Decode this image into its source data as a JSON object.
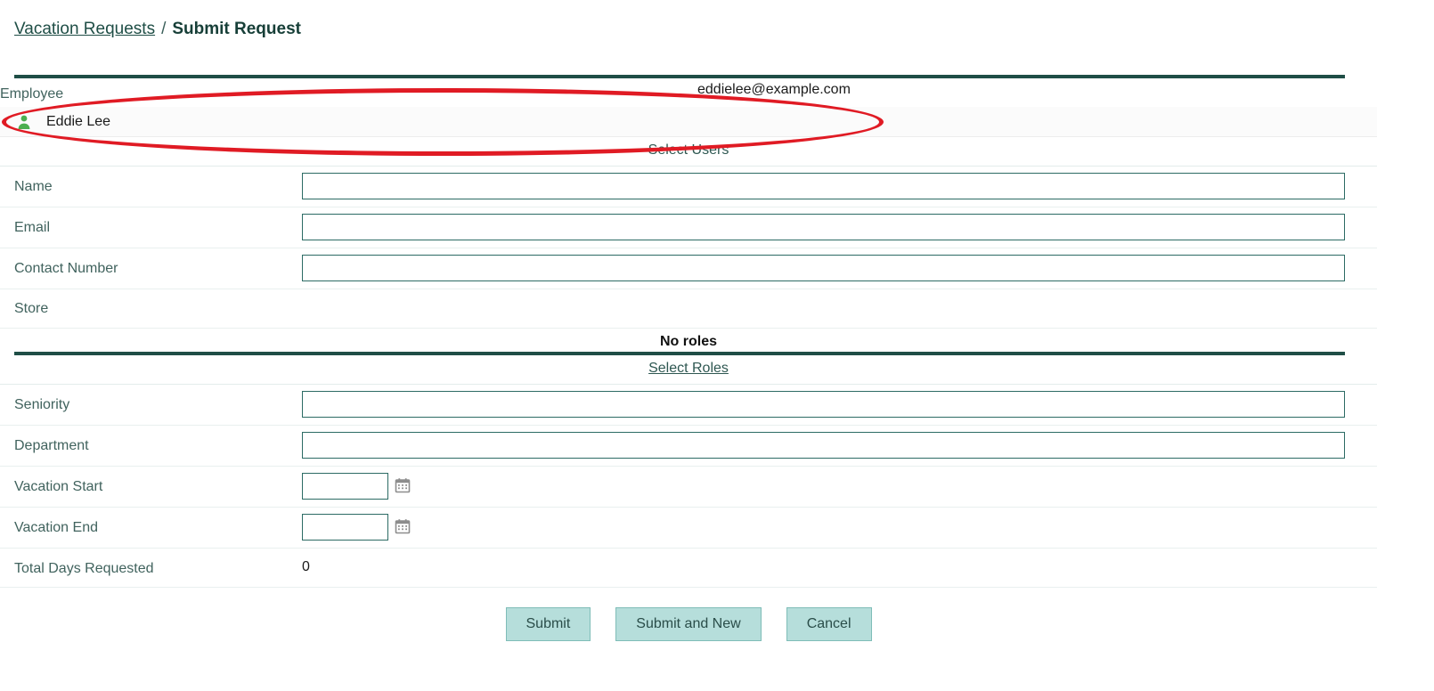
{
  "breadcrumb": {
    "parent": "Vacation Requests",
    "separator": "/",
    "current": "Submit Request"
  },
  "employee_section": {
    "label": "Employee",
    "icon": "person-icon",
    "name": "Eddie Lee",
    "email": "eddielee@example.com",
    "select_users_link": "Select Users"
  },
  "user_fields": [
    {
      "label": "Name",
      "value": "",
      "type": "text"
    },
    {
      "label": "Email",
      "value": "",
      "type": "text"
    },
    {
      "label": "Contact Number",
      "value": "",
      "type": "text"
    }
  ],
  "store_label": "Store",
  "roles_section": {
    "empty_text": "No roles",
    "select_roles_link": "Select Roles"
  },
  "request_fields": [
    {
      "label": "Seniority",
      "value": "",
      "type": "text"
    },
    {
      "label": "Department",
      "value": "",
      "type": "text"
    },
    {
      "label": "Vacation Start",
      "value": "",
      "type": "date",
      "icon": "calendar-icon"
    },
    {
      "label": "Vacation End",
      "value": "",
      "type": "date",
      "icon": "calendar-icon"
    }
  ],
  "total_days": {
    "label": "Total Days Requested",
    "value": "0"
  },
  "buttons": {
    "submit": "Submit",
    "submit_and_new": "Submit and New",
    "cancel": "Cancel"
  },
  "colors": {
    "accent": "#1f4e46",
    "input_border": "#2c6b64",
    "button_fill": "#b6dedb",
    "button_border": "#7fbdb8",
    "annotation": "#e01b24",
    "person_icon": "#4caf50"
  }
}
